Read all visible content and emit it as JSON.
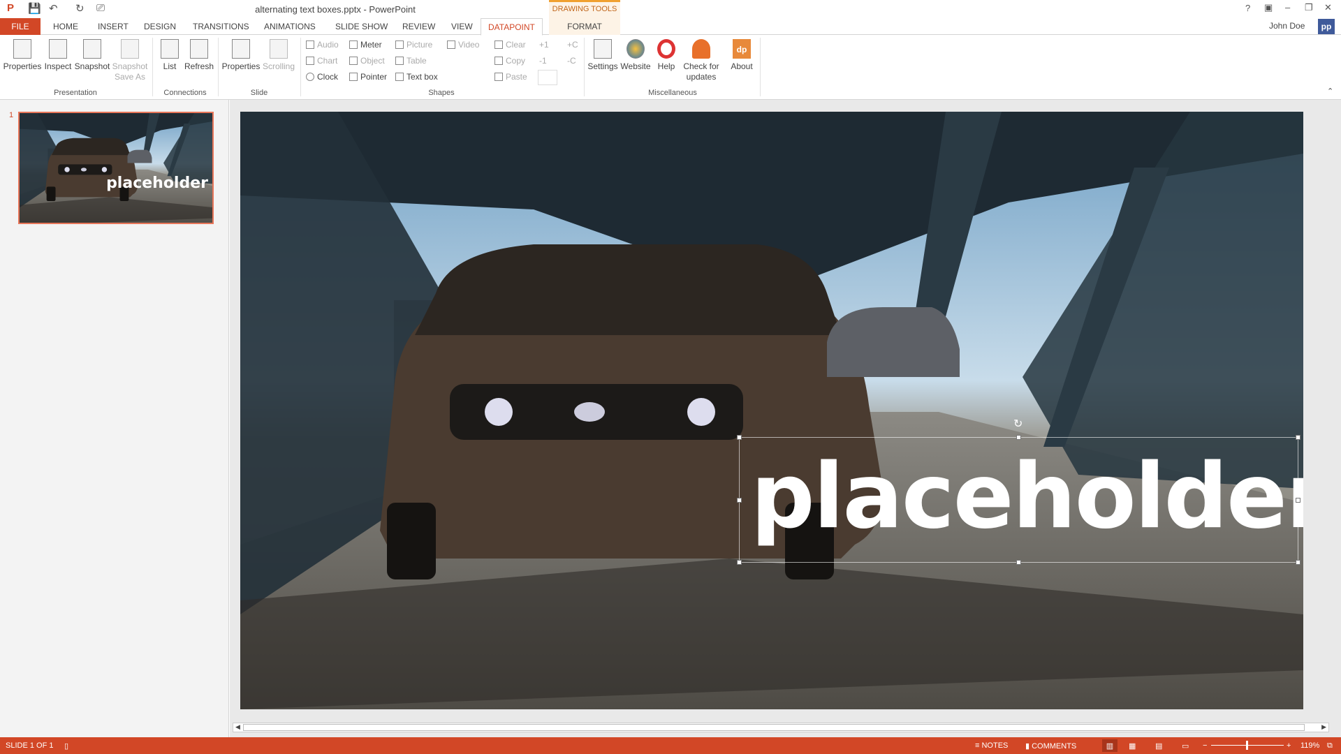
{
  "window": {
    "title": "alternating text boxes.pptx - PowerPoint",
    "context_tab": "DRAWING TOOLS",
    "user": "John Doe",
    "avatar": "pp",
    "controls": [
      "?",
      "▣",
      "–",
      "❐",
      "✕"
    ]
  },
  "tabs": [
    "FILE",
    "HOME",
    "INSERT",
    "DESIGN",
    "TRANSITIONS",
    "ANIMATIONS",
    "SLIDE SHOW",
    "REVIEW",
    "VIEW",
    "DATAPOINT",
    "FORMAT"
  ],
  "active_tab": "DATAPOINT",
  "ribbon": {
    "presentation": {
      "label": "Presentation",
      "items": [
        "Properties",
        "Inspect",
        "Snapshot",
        "Snapshot Save As"
      ]
    },
    "connections": {
      "label": "Connections",
      "items": [
        "List",
        "Refresh"
      ]
    },
    "slide": {
      "label": "Slide",
      "items": [
        "Properties",
        "Scrolling"
      ]
    },
    "shapes": {
      "label": "Shapes",
      "items": [
        "Audio",
        "Chart",
        "Clock",
        "Meter",
        "Object",
        "Pointer",
        "Picture",
        "Table",
        "Text box",
        "Video",
        "Clear",
        "Copy",
        "Paste",
        "+1",
        "-1",
        "+C",
        "-C"
      ]
    },
    "misc": {
      "label": "Miscellaneous",
      "items": [
        "Settings",
        "Website",
        "Help",
        "Check for updates",
        "About"
      ],
      "about_logo": "dp"
    }
  },
  "slides": {
    "thumbnail_number": "1",
    "thumbnail_text": "placeholder"
  },
  "slide": {
    "text": "placeholder"
  },
  "status": {
    "slide": "SLIDE 1 OF 1",
    "notes": "NOTES",
    "comments": "COMMENTS",
    "zoom": "119%",
    "zoom_level": 119
  },
  "colors": {
    "accent": "#d24726",
    "context": "#f0a030"
  }
}
